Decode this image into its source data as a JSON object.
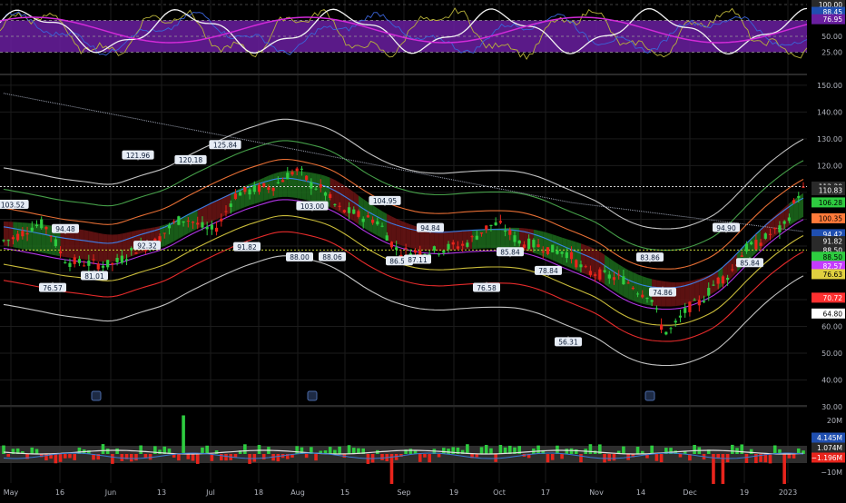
{
  "colors": {
    "background": "#000000",
    "grid": "#1b1b1b",
    "axis_text": "#b2b5be",
    "bull": "#2ecc40",
    "bear": "#e8241c",
    "rsi_band": "#6a1fa0",
    "rsi_mid": "#d22ad8",
    "rsi_fast": "#f3f3f3",
    "rsi_blue": "#3a63d8",
    "rsi_olive": "#b8b23a",
    "band_outer": "#d8d8d8",
    "band_green": "#4caf50",
    "band_orange": "#ff7a3a",
    "band_blue": "#3a8bff",
    "band_purple": "#c43bff",
    "band_yellow": "#e0d040",
    "band_red": "#ff3030",
    "cloud_green": "#1c6b1c",
    "cloud_red": "#6b1414",
    "vol_avg": "#e0e0e0",
    "vol_blue": "#3a7bd5",
    "vol_band": "#3a3a3a"
  },
  "chart_data": [
    {
      "type": "line",
      "panel": "oscillator",
      "y_ticks": [
        "100.00",
        "50.00",
        "25.00"
      ],
      "ylim": [
        0,
        100
      ],
      "badges": [
        {
          "text": "100.00",
          "value": 100,
          "color": "#2a2a2a"
        },
        {
          "text": "88.45",
          "value": 88.45,
          "color": "#1f4fb0"
        },
        {
          "text": "76.95",
          "value": 76.95,
          "color": "#6a1fa0"
        }
      ],
      "band": [
        25,
        75
      ]
    },
    {
      "type": "candlestick",
      "panel": "price",
      "x_labels": [
        "May",
        "16",
        "Jun",
        "13",
        "Jul",
        "18",
        "Aug",
        "15",
        "Sep",
        "19",
        "Oct",
        "17",
        "Nov",
        "14",
        "Dec",
        "19",
        "2023"
      ],
      "y_ticks": [
        "150.00",
        "140.00",
        "130.00",
        "120.00",
        "110.00",
        "100.00",
        "90.00",
        "80.00",
        "70.00",
        "60.00",
        "50.00",
        "40.00",
        "30.00"
      ],
      "ylim": [
        30,
        152
      ],
      "badges": [
        {
          "text": "112.20",
          "value": 112.2,
          "color": "#2a2a2a"
        },
        {
          "text": "110.83",
          "value": 110.83,
          "color": "#2a2a2a"
        },
        {
          "text": "106.28",
          "value": 106.28,
          "color": "#2ecc40"
        },
        {
          "text": "100.35",
          "value": 100.35,
          "color": "#ff7a3a"
        },
        {
          "text": "94.42",
          "value": 94.42,
          "color": "#1f4fb0"
        },
        {
          "text": "91.82",
          "value": 91.82,
          "color": "#2a2a2a"
        },
        {
          "text": "88.50",
          "value": 88.5,
          "color": "#2a2a2a"
        },
        {
          "text": "88.50",
          "value": 86.0,
          "color": "#2ecc40"
        },
        {
          "text": "82.57",
          "value": 82.57,
          "color": "#c43bff"
        },
        {
          "text": "76.63",
          "value": 79.5,
          "color": "#e0d040"
        },
        {
          "text": "70.72",
          "value": 70.72,
          "color": "#ff3030"
        },
        {
          "text": "64.80",
          "value": 64.8,
          "color": "#ffffff"
        }
      ],
      "annotations": [
        {
          "text": "103.52",
          "value": 103.52,
          "pos": "above"
        },
        {
          "text": "76.57",
          "value": 76.57,
          "pos": "below"
        },
        {
          "text": "94.48",
          "value": 94.48,
          "pos": "above"
        },
        {
          "text": "81.01",
          "value": 81.01,
          "pos": "below"
        },
        {
          "text": "121.96",
          "value": 121.96,
          "pos": "above"
        },
        {
          "text": "92.32",
          "value": 92.32,
          "pos": "below"
        },
        {
          "text": "120.18",
          "value": 120.18,
          "pos": "above"
        },
        {
          "text": "125.84",
          "value": 125.84,
          "pos": "above"
        },
        {
          "text": "91.82",
          "value": 91.82,
          "pos": "below"
        },
        {
          "text": "103.00",
          "value": 103.0,
          "pos": "above"
        },
        {
          "text": "88.00",
          "value": 88.0,
          "pos": "below"
        },
        {
          "text": "88.06",
          "value": 88.06,
          "pos": "below"
        },
        {
          "text": "104.95",
          "value": 104.95,
          "pos": "above"
        },
        {
          "text": "86.51",
          "value": 86.51,
          "pos": "below"
        },
        {
          "text": "87.11",
          "value": 87.11,
          "pos": "below"
        },
        {
          "text": "94.84",
          "value": 94.84,
          "pos": "above"
        },
        {
          "text": "76.58",
          "value": 76.58,
          "pos": "below"
        },
        {
          "text": "85.84",
          "value": 85.84,
          "pos": "above"
        },
        {
          "text": "78.84",
          "value": 78.84,
          "pos": "above"
        },
        {
          "text": "56.31",
          "value": 56.31,
          "pos": "below"
        },
        {
          "text": "83.86",
          "value": 83.86,
          "pos": "above"
        },
        {
          "text": "74.86",
          "value": 74.86,
          "pos": "below"
        },
        {
          "text": "94.90",
          "value": 94.9,
          "pos": "above"
        },
        {
          "text": "85.84",
          "value": 85.84,
          "pos": "below"
        }
      ],
      "reference_lines": [
        {
          "value": 112.2,
          "color": "#cfcfcf"
        },
        {
          "value": 88.5,
          "color": "#c8d23a"
        }
      ]
    },
    {
      "type": "bar",
      "panel": "volume",
      "y_ticks": [
        "20M",
        "−10M"
      ],
      "badges": [
        {
          "text": "4.145M",
          "value": 4.145,
          "color": "#1f4fb0"
        },
        {
          "text": "1.074M",
          "value": 1.074,
          "color": "#2a2a2a"
        },
        {
          "text": "−1.196M",
          "value": -1.196,
          "color": "#e8241c"
        }
      ]
    }
  ]
}
